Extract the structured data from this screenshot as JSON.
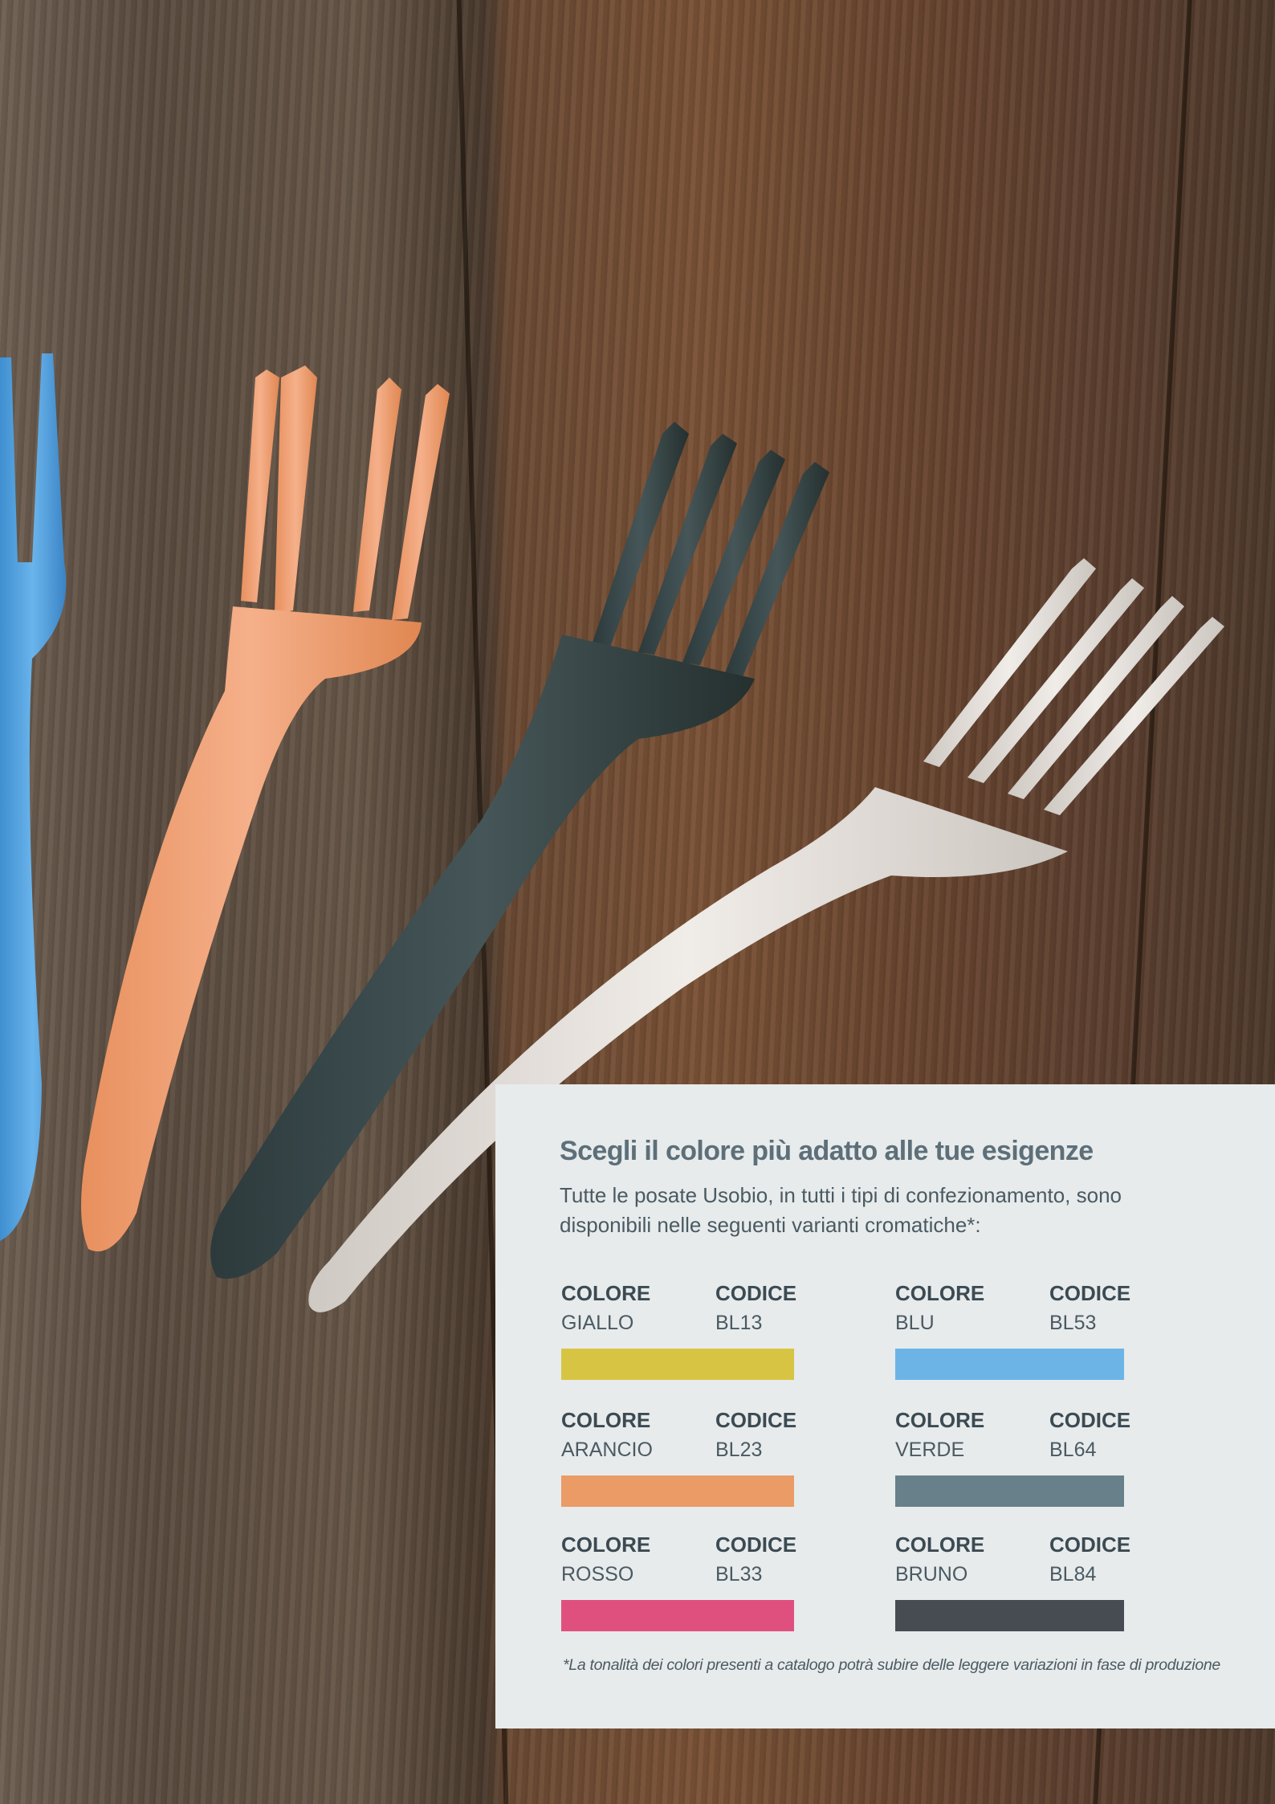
{
  "photo": {
    "subject": "forks",
    "colors": {
      "blue_fork": "#5aa8e4",
      "orange_fork": "#f0a070",
      "dark_fork": "#3a4a4c",
      "white_fork": "#e2ddd8",
      "wood_dark": "#4a3a2e",
      "wood_light": "#7a5236"
    }
  },
  "panel": {
    "title": "Scegli il colore più adatto alle tue esigenze",
    "intro": "Tutte le posate Usobio, in tutti i tipi di confezionamento, sono disponibili nelle seguenti varianti cromatiche*:",
    "colore_label": "COLORE",
    "codice_label": "CODICE",
    "swatches": [
      {
        "name": "GIALLO",
        "code": "BL13",
        "color": "#d8c443"
      },
      {
        "name": "BLU",
        "code": "BL53",
        "color": "#6db4e6"
      },
      {
        "name": "ARANCIO",
        "code": "BL23",
        "color": "#eb9b66"
      },
      {
        "name": "VERDE",
        "code": "BL64",
        "color": "#67808a"
      },
      {
        "name": "ROSSO",
        "code": "BL33",
        "color": "#e0507e"
      },
      {
        "name": "BRUNO",
        "code": "BL84",
        "color": "#474c52"
      }
    ],
    "footnote": "*La tonalità dei colori presenti a catalogo potrà subire delle leggere variazioni in fase di produzione",
    "background": "#e7ebec"
  }
}
